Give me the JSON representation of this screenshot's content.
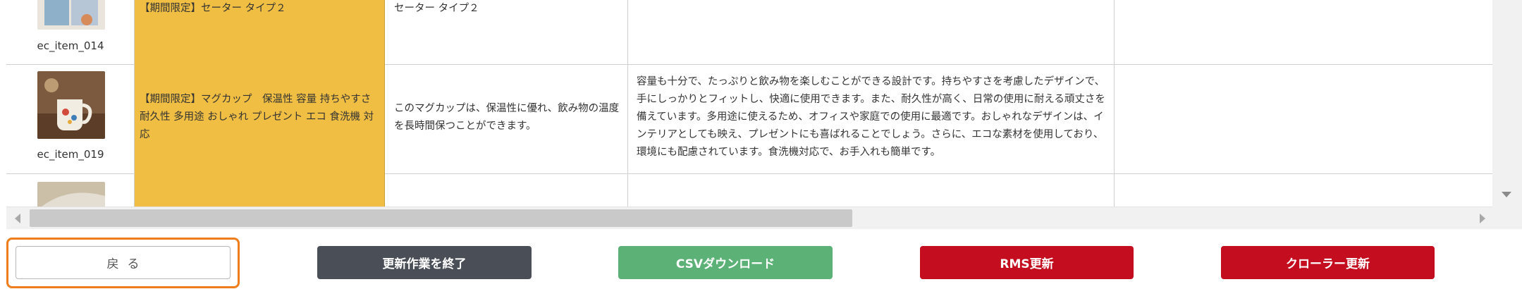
{
  "rows": [
    {
      "item_id": "ec_item_014",
      "title": "【期間限定】セーター タイプ２",
      "short_desc": "セーター タイプ２",
      "long_desc": ""
    },
    {
      "item_id": "ec_item_019",
      "title": "【期間限定】マグカップ　保温性 容量 持ちやすさ 耐久性 多用途 おしゃれ プレゼント エコ 食洗機 対応",
      "short_desc": "このマグカップは、保温性に優れ、飲み物の温度を長時間保つことができます。",
      "long_desc": "容量も十分で、たっぷりと飲み物を楽しむことができる設計です。持ちやすさを考慮したデザインで、手にしっかりとフィットし、快適に使用できます。また、耐久性が高く、日常の使用に耐える頑丈さを備えています。多用途に使えるため、オフィスや家庭での使用に最適です。おしゃれなデザインは、インテリアとしても映え、プレゼントにも喜ばれることでしょう。さらに、エコな素材を使用しており、環境にも配慮されています。食洗機対応で、お手入れも簡単です。"
    }
  ],
  "footer": {
    "back_label": "戻る",
    "finish_label": "更新作業を終了",
    "csv_label": "CSVダウンロード",
    "rms_label": "RMS更新",
    "crawler_label": "クローラー更新"
  },
  "colors": {
    "title_cell": "#f0be42",
    "finish": "#4a4f57",
    "csv": "#5cb176",
    "rms": "#c40d1e",
    "crawler": "#c40d1e",
    "focus_outline": "#f07d1c"
  }
}
